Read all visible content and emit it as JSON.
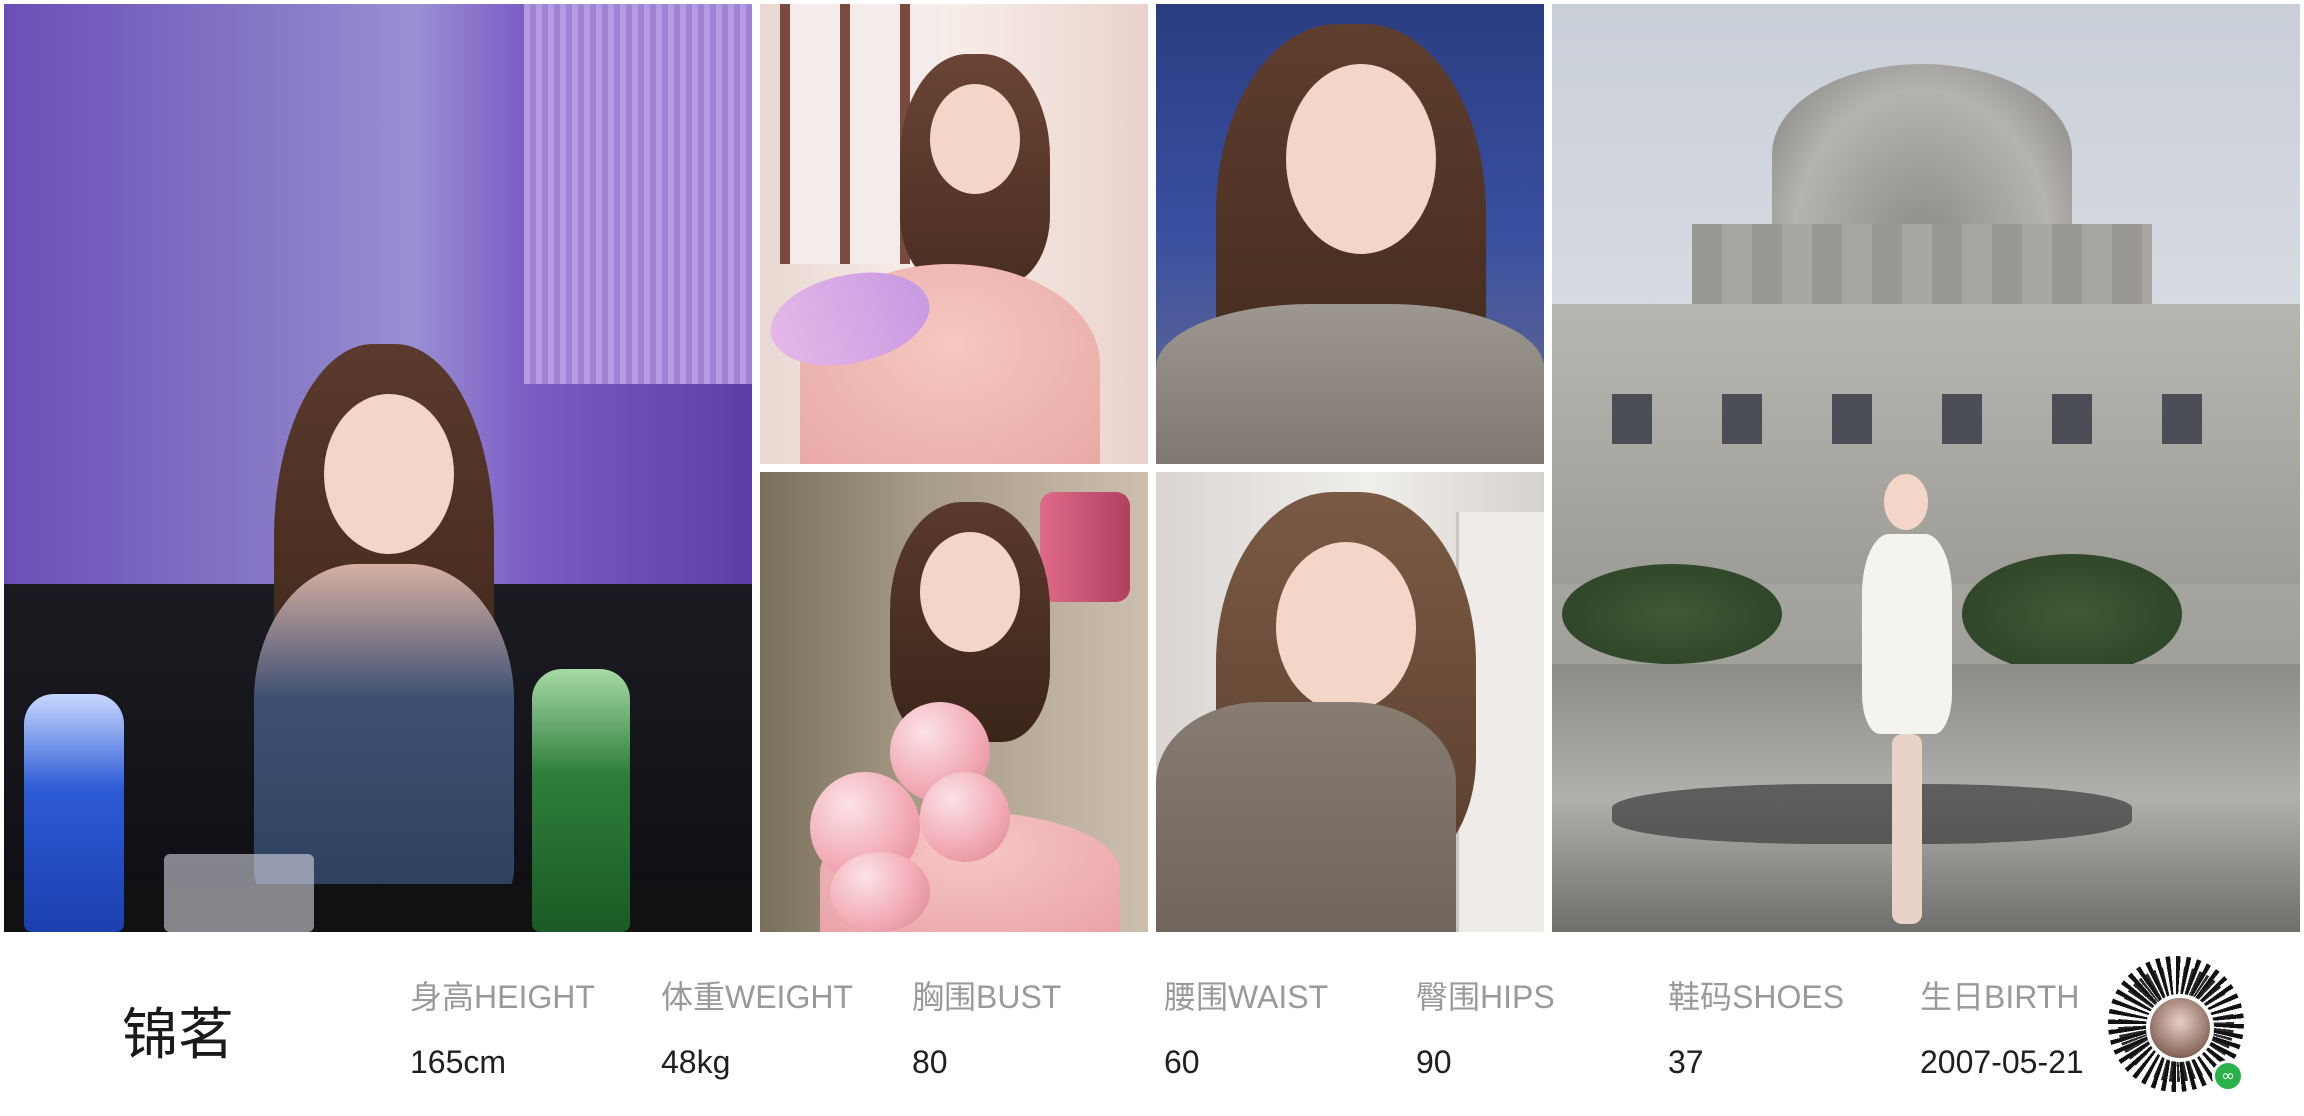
{
  "model": {
    "name": "锦茗"
  },
  "stats": [
    {
      "label": "身高HEIGHT",
      "value": "165cm"
    },
    {
      "label": "体重WEIGHT",
      "value": "48kg"
    },
    {
      "label": "胸围BUST",
      "value": "80"
    },
    {
      "label": "腰围WAIST",
      "value": "60"
    },
    {
      "label": "臀围HIPS",
      "value": "90"
    },
    {
      "label": "鞋码SHOES",
      "value": "37"
    },
    {
      "label": "生日BIRTH",
      "value": "2007-05-21"
    }
  ],
  "photos": [
    {
      "icon": "portrait-photo"
    },
    {
      "icon": "portrait-photo"
    },
    {
      "icon": "portrait-photo"
    },
    {
      "icon": "portrait-photo"
    },
    {
      "icon": "portrait-photo"
    },
    {
      "icon": "portrait-photo"
    }
  ],
  "qr": {
    "icon": "mini-program-qr-code"
  }
}
